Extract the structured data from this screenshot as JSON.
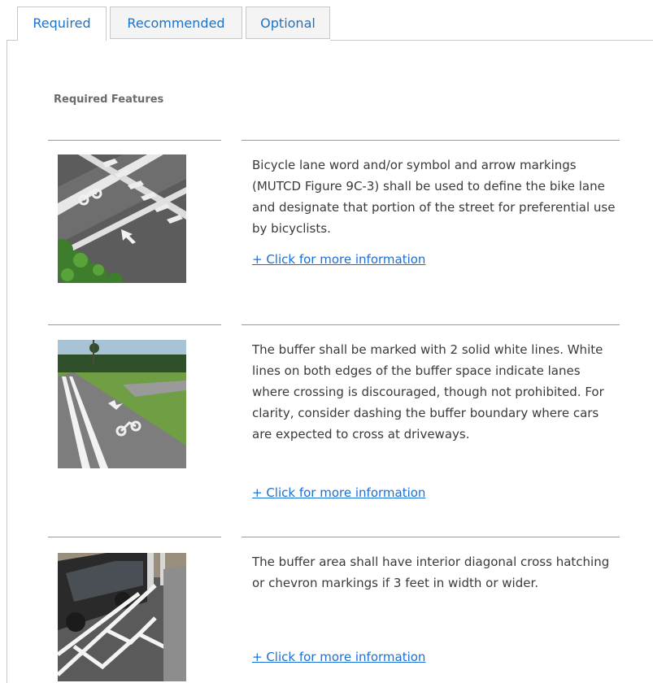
{
  "tabs": [
    {
      "label": "Required",
      "active": true
    },
    {
      "label": "Recommended",
      "active": false
    },
    {
      "label": "Optional",
      "active": false
    }
  ],
  "section": {
    "heading": "Required Features"
  },
  "features": [
    {
      "description": "Bicycle lane word and/or symbol and arrow markings (MUTCD Figure 9C-3) shall be used to define the bike lane and designate that portion of the street for preferential use by bicyclists.",
      "link": "+ Click for more information"
    },
    {
      "description": "The buffer shall be marked with 2 solid white lines. White lines on both edges of the buffer space indicate lanes where crossing is discouraged, though not prohibited. For clarity, consider dashing the buffer boundary where cars are expected to cross at driveways.",
      "link": "+ Click for more information"
    },
    {
      "description": "The buffer area shall have interior diagonal cross hatching or chevron markings if 3 feet in width or wider.",
      "link": "+ Click for more information"
    }
  ],
  "colors": {
    "link": "#1a6fd6",
    "tab_text": "#1a73c8",
    "heading": "#6b6b6b",
    "border": "#c8c8c8"
  }
}
